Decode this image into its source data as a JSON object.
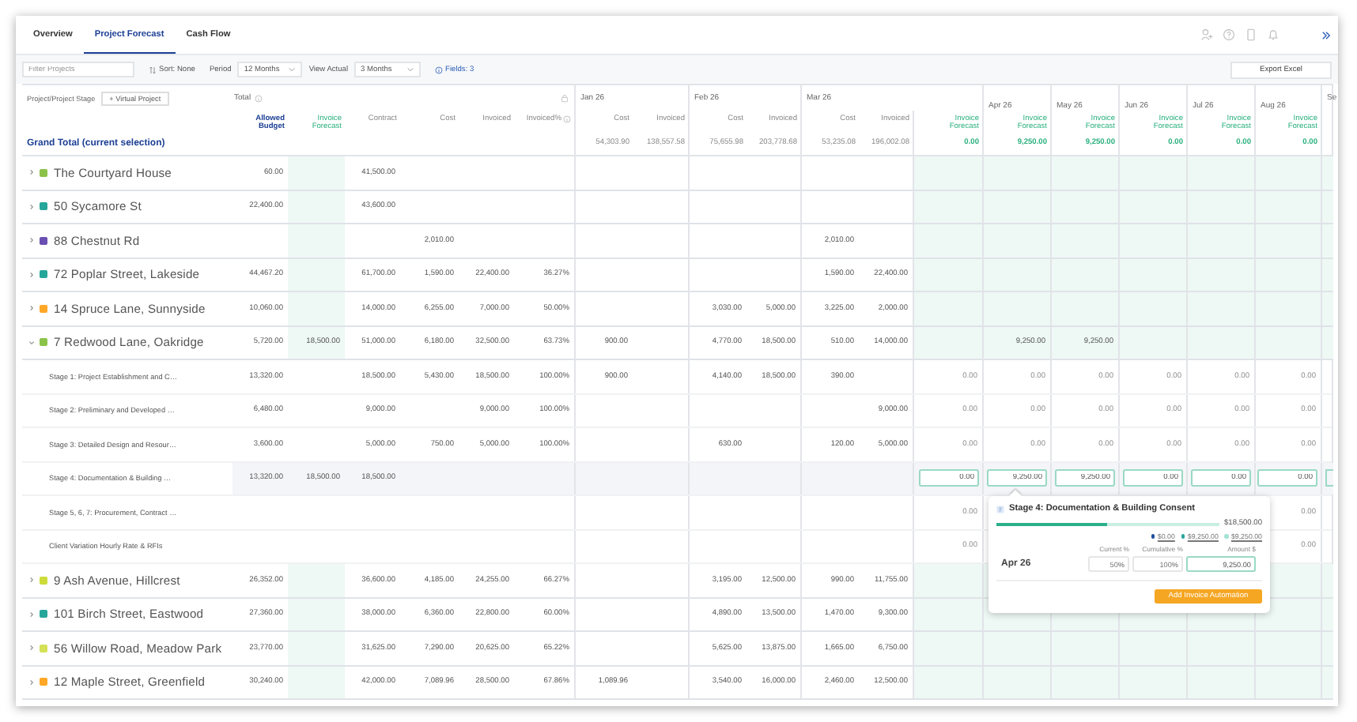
{
  "tabs": [
    {
      "label": "Overview",
      "selected": false
    },
    {
      "label": "Project Forecast",
      "selected": true
    },
    {
      "label": "Cash Flow",
      "selected": false
    }
  ],
  "toolbar": {
    "filter_placeholder": "Filter Projects",
    "sort": "Sort: None",
    "period_label": "Period",
    "period": "12 Months",
    "view_actual_label": "View Actual",
    "view_actual": "3 Months",
    "fields": "Fields: 3",
    "export": "Export Excel"
  },
  "table": {
    "stage_heading": "Project/Project Stage",
    "virtual_project": "+ Virtual Project",
    "total_label": "Total",
    "grand_total": "Grand Total (current selection)",
    "total_columns": [
      {
        "label": "Allowed Budget",
        "kind": "budget"
      },
      {
        "label": "Invoice Forecast",
        "kind": "forecast"
      },
      {
        "label": "Contract",
        "kind": "amount"
      },
      {
        "label": "Cost",
        "kind": "amount"
      },
      {
        "label": "Invoiced",
        "kind": "amount"
      },
      {
        "label": "Invoiced%",
        "kind": "percent"
      }
    ],
    "months": [
      {
        "label": "Jan 26",
        "columns": [
          {
            "label": "Cost",
            "kind": "amount"
          },
          {
            "label": "Invoiced",
            "kind": "amount"
          }
        ]
      },
      {
        "label": "Feb 26",
        "columns": [
          {
            "label": "Cost",
            "kind": "amount"
          },
          {
            "label": "Invoiced",
            "kind": "amount"
          }
        ]
      },
      {
        "label": "Mar 26",
        "columns": [
          {
            "label": "Cost",
            "kind": "amount"
          },
          {
            "label": "Invoiced",
            "kind": "amount"
          },
          {
            "label": "Invoice Forecast",
            "kind": "forecast"
          }
        ]
      },
      {
        "label": "Apr 26",
        "columns": [
          {
            "label": "Invoice Forecast",
            "kind": "forecast"
          }
        ]
      },
      {
        "label": "May 26",
        "columns": [
          {
            "label": "Invoice Forecast",
            "kind": "forecast"
          }
        ]
      },
      {
        "label": "Jun 26",
        "columns": [
          {
            "label": "Invoice Forecast",
            "kind": "forecast"
          }
        ]
      },
      {
        "label": "Jul 26",
        "columns": [
          {
            "label": "Invoice Forecast",
            "kind": "forecast"
          }
        ]
      },
      {
        "label": "Aug 26",
        "columns": [
          {
            "label": "Invoice Forecast",
            "kind": "forecast"
          }
        ]
      },
      {
        "label": "Se"
      }
    ],
    "totals": {
      "jan_cost": "54,303.90",
      "jan_invoiced": "138,557.58",
      "feb_cost": "75,655.98",
      "feb_invoiced": "203,778.68",
      "mar_cost": "53,235.08",
      "mar_invoiced": "196,002.08",
      "mar_forecast": "0.00",
      "apr_forecast": "9,250.00",
      "may_forecast": "9,250.00",
      "jun_forecast": "0.00",
      "jul_forecast": "0.00",
      "aug_forecast": "0.00"
    },
    "rows": [
      {
        "name": "The Courtyard House",
        "color": "#8bc34a",
        "expanded": false,
        "cells": {
          "budget": "60.00",
          "contract": "41,500.00"
        }
      },
      {
        "name": "50 Sycamore St",
        "color": "#26a69a",
        "expanded": false,
        "cells": {
          "budget": "22,400.00",
          "contract": "43,600.00"
        }
      },
      {
        "name": "88 Chestnut Rd",
        "color": "#6a4fb3",
        "expanded": false,
        "cells": {
          "cost": "2,010.00",
          "mar_cost": "2,010.00"
        }
      },
      {
        "name": "72 Poplar Street, Lakeside",
        "color": "#26a69a",
        "expanded": false,
        "cells": {
          "budget": "44,467.20",
          "contract": "61,700.00",
          "cost": "1,590.00",
          "invoiced": "22,400.00",
          "invoiced_pct": "36.27%",
          "mar_cost": "1,590.00",
          "mar_invoiced": "22,400.00"
        }
      },
      {
        "name": "14 Spruce Lane, Sunnyside",
        "color": "#ffa726",
        "expanded": false,
        "cells": {
          "budget": "10,060.00",
          "contract": "14,000.00",
          "cost": "6,255.00",
          "invoiced": "7,000.00",
          "invoiced_pct": "50.00%",
          "feb_cost": "3,030.00",
          "feb_invoiced": "5,000.00",
          "mar_cost": "3,225.00",
          "mar_invoiced": "2,000.00"
        }
      },
      {
        "name": "7 Redwood Lane, Oakridge",
        "color": "#8bc34a",
        "expanded": true,
        "cells": {
          "budget": "5,720.00",
          "forecast": "18,500.00",
          "contract": "51,000.00",
          "cost": "6,180.00",
          "invoiced": "32,500.00",
          "invoiced_pct": "63.73%",
          "jan_cost": "900.00",
          "feb_cost": "4,770.00",
          "feb_invoiced": "18,500.00",
          "mar_cost": "510.00",
          "mar_invoiced": "14,000.00",
          "apr_forecast": "9,250.00",
          "may_forecast": "9,250.00"
        },
        "children": [
          {
            "name": "Stage 1: Project Establishment and C…",
            "selected": false,
            "cells": {
              "budget": "13,320.00",
              "contract": "18,500.00",
              "cost": "5,430.00",
              "invoiced": "18,500.00",
              "invoiced_pct": "100.00%",
              "jan_cost": "900.00",
              "feb_cost": "4,140.00",
              "feb_invoiced": "18,500.00",
              "mar_cost": "390.00",
              "mar_forecast": "0.00",
              "apr_forecast": "0.00",
              "may_forecast": "0.00",
              "jun_forecast": "0.00",
              "jul_forecast": "0.00",
              "aug_forecast": "0.00"
            }
          },
          {
            "name": "Stage 2: Preliminary and Developed …",
            "selected": false,
            "cells": {
              "budget": "6,480.00",
              "contract": "9,000.00",
              "invoiced": "9,000.00",
              "invoiced_pct": "100.00%",
              "mar_invoiced": "9,000.00",
              "mar_forecast": "0.00",
              "apr_forecast": "0.00",
              "may_forecast": "0.00",
              "jun_forecast": "0.00",
              "jul_forecast": "0.00",
              "aug_forecast": "0.00"
            }
          },
          {
            "name": "Stage 3: Detailed Design and Resour…",
            "selected": false,
            "cells": {
              "budget": "3,600.00",
              "contract": "5,000.00",
              "cost": "750.00",
              "invoiced": "5,000.00",
              "invoiced_pct": "100.00%",
              "feb_cost": "630.00",
              "mar_cost": "120.00",
              "mar_invoiced": "5,000.00",
              "mar_forecast": "0.00",
              "apr_forecast": "0.00",
              "may_forecast": "0.00",
              "jun_forecast": "0.00",
              "jul_forecast": "0.00",
              "aug_forecast": "0.00"
            }
          },
          {
            "name": "Stage 4: Documentation & Building …",
            "selected": true,
            "cells": {
              "budget": "13,320.00",
              "forecast": "18,500.00",
              "contract": "18,500.00",
              "mar_forecast": "0.00",
              "apr_forecast": "9,250.00",
              "may_forecast": "9,250.00",
              "jun_forecast": "0.00",
              "jul_forecast": "0.00",
              "aug_forecast": "0.00"
            }
          },
          {
            "name": "Stage 5, 6, 7: Procurement, Contract …",
            "selected": false,
            "cells": {
              "mar_forecast": "0.00",
              "aug_forecast": "0.00"
            }
          },
          {
            "name": "Client Variation Hourly Rate & RFIs",
            "selected": false,
            "cells": {
              "mar_forecast": "0.00",
              "aug_forecast": "0.00"
            }
          }
        ]
      },
      {
        "name": "9 Ash Avenue, Hillcrest",
        "color": "#cddc39",
        "expanded": false,
        "cells": {
          "budget": "26,352.00",
          "contract": "36,600.00",
          "cost": "4,185.00",
          "invoiced": "24,255.00",
          "invoiced_pct": "66.27%",
          "feb_cost": "3,195.00",
          "feb_invoiced": "12,500.00",
          "mar_cost": "990.00",
          "mar_invoiced": "11,755.00"
        }
      },
      {
        "name": "101 Birch Street, Eastwood",
        "color": "#26a69a",
        "expanded": false,
        "cells": {
          "budget": "27,360.00",
          "contract": "38,000.00",
          "cost": "6,360.00",
          "invoiced": "22,800.00",
          "invoiced_pct": "60.00%",
          "feb_cost": "4,890.00",
          "feb_invoiced": "13,500.00",
          "mar_cost": "1,470.00",
          "mar_invoiced": "9,300.00"
        }
      },
      {
        "name": "56 Willow Road, Meadow Park",
        "color": "#d4e157",
        "expanded": false,
        "cells": {
          "budget": "23,770.00",
          "contract": "31,625.00",
          "cost": "7,290.00",
          "invoiced": "20,625.00",
          "invoiced_pct": "65.22%",
          "feb_cost": "5,625.00",
          "feb_invoiced": "13,875.00",
          "mar_cost": "1,665.00",
          "mar_invoiced": "6,750.00"
        }
      },
      {
        "name": "12 Maple Street, Greenfield",
        "color": "#ffa726",
        "expanded": false,
        "cells": {
          "budget": "30,240.00",
          "contract": "42,000.00",
          "cost": "7,089.96",
          "invoiced": "28,500.00",
          "invoiced_pct": "67.86%",
          "jan_cost": "1,089.96",
          "feb_cost": "3,540.00",
          "feb_invoiced": "16,000.00",
          "mar_cost": "2,460.00",
          "mar_invoiced": "12,500.00"
        }
      }
    ]
  },
  "popover": {
    "title": "Stage 4: Documentation & Building Consent",
    "level": 0.5,
    "amount": "$18,500.00",
    "legend": [
      {
        "label": "$0.00",
        "color": "#1e4fa0"
      },
      {
        "label": "$9,250.00",
        "color": "#26a69a"
      },
      {
        "label": "$9,250.00",
        "color": "#a5e3d5"
      }
    ],
    "columns": [
      "Current %",
      "Cumulative %",
      "Amount $"
    ],
    "month": "Apr 26",
    "fields": [
      {
        "value": "50",
        "unit": "%"
      },
      {
        "value": "100",
        "unit": "%"
      },
      {
        "value": "9,250.00"
      }
    ],
    "button": "Add Invoice Automation"
  }
}
